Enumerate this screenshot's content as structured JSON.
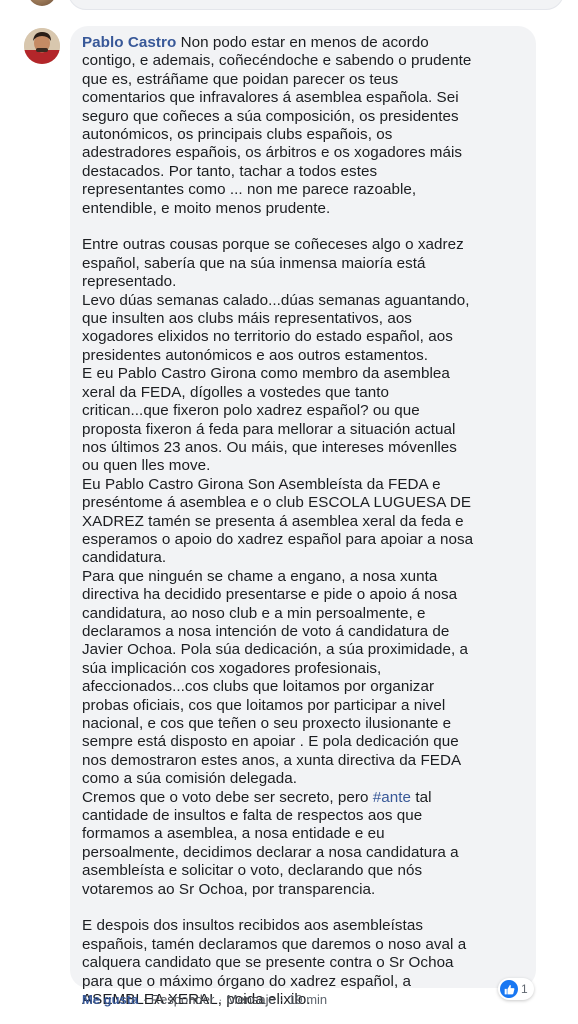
{
  "comment": {
    "author": "Pablo Castro",
    "intro": "Non podo estar en menos de acordo\ncontigo, e ademais, coñecéndoche e sabendo o prudente\nque es, estráñame que poidan parecer os teus\ncomentarios que infravalores á asemblea española. Sei\nseguro que coñeces a súa composición, os presidentes\nautonómicos, os principais clubs españois, os\nadestradores españois, os árbitros e os xogadores máis\ndestacados. Por tanto, tachar a todos estes\nrepresentantes como ... non me parece razoable,\nentendible, e moito menos prudente.",
    "para2": "Entre outras cousas porque se coñeceses algo o xadrez\nespañol, sabería que na súa inmensa maioría está\nrepresentado.\nLevo dúas semanas calado...dúas semanas aguantando,\nque insulten aos clubs máis representativos, aos\nxogadores elixidos no territorio do estado español, aos\npresidentes autonómicos e aos outros estamentos.\nE eu Pablo Castro Girona como membro da asemblea\nxeral da FEDA, dígolles a vostedes que tanto\ncritican...que fixeron polo xadrez español? ou que\nproposta fixeron á feda para mellorar a situación actual\nnos últimos 23 anos. Ou máis, que intereses móvenlles\nou quen lles move.\nEu Pablo Castro Girona Son Asembleísta da FEDA e\npreséntome á asemblea e o club ESCOLA LUGUESA DE\nXADREZ tamén se presenta á asemblea xeral da feda e\nesperamos o apoio do xadrez español para apoiar a nosa\ncandidatura.\nPara que ninguén se chame a engano, a nosa xunta\ndirectiva ha decidido presentarse e pide o apoio á nosa\ncandidatura, ao noso club e a min persoalmente, e\ndeclaramos a nosa intención de voto á candidatura de\nJavier Ochoa. Pola súa dedicación, a súa proximidade, a\nsúa implicación cos xogadores profesionais,\nafeccionados...cos clubs que loitamos por organizar\nprobas oficiais, cos que loitamos por participar a nivel\nnacional, e cos que teñen o seu proxecto ilusionante e\nsempre está disposto en apoiar . E pola dedicación que\nnos demostraron estes anos, a xunta directiva da FEDA\ncomo a súa comisión delegada.\nCremos que o voto debe ser secreto, pero ",
    "hashtag": "#ante",
    "para2_end": " tal\ncantidade de insultos e falta de respectos aos que\nformamos a asemblea, a nosa entidade e eu\npersoalmente, decidimos declarar a nosa candidatura a\nasembleísta e solicitar o voto, declarando que nós\nvotaremos ao Sr Ochoa, por transparencia.",
    "para3": "E despois dos insultos recibidos aos asembleístas\nespañois, tamén declaramos que daremos o noso aval a\ncalquera candidato que se presente contra o Sr Ochoa\npara que o máximo órgano do xadrez español, a\nASEMBLEA XERAL, poida elixilo."
  },
  "actions": {
    "like": "Me gusta",
    "reply": "Responder",
    "message": "Mensaje",
    "time": "19 min",
    "separator": "·"
  },
  "reactions": {
    "count": "1",
    "icon": "thumbs-up-icon",
    "color": "#1877f2"
  },
  "colors": {
    "link": "#385898",
    "bubble": "#f2f3f5"
  }
}
